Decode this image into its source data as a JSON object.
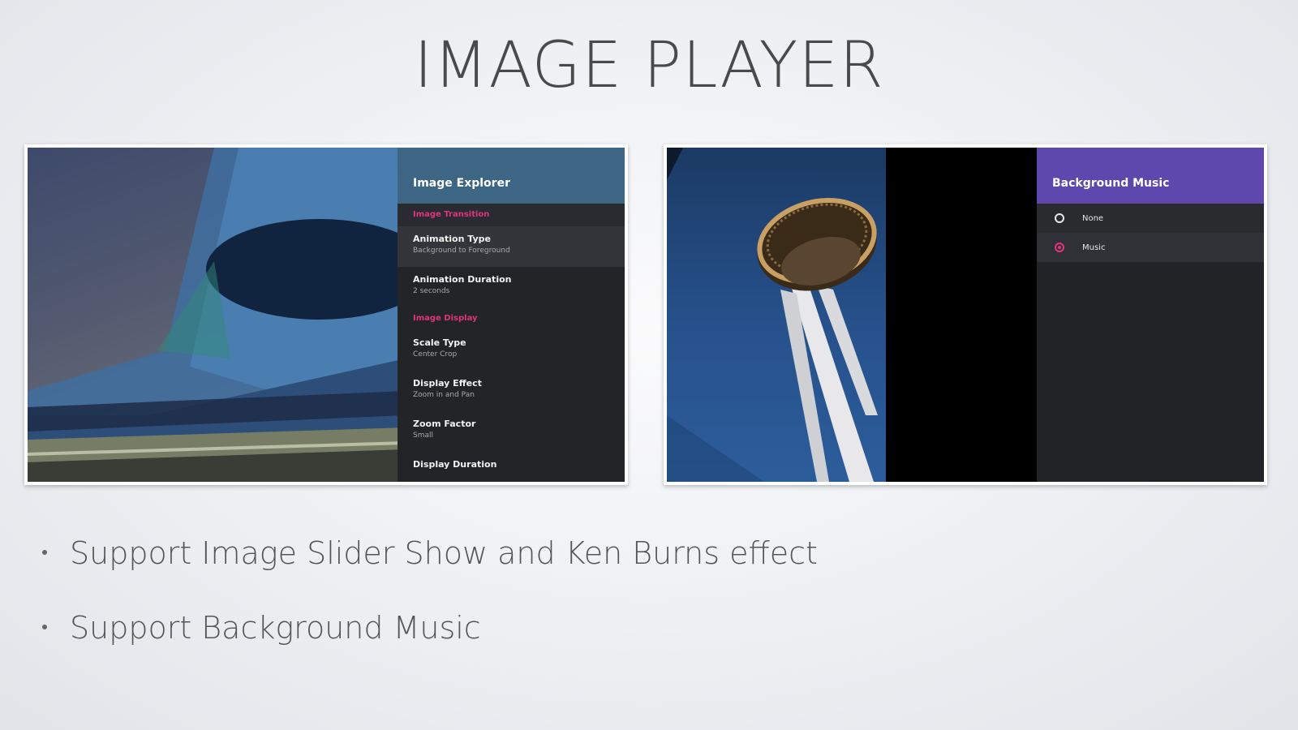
{
  "slide": {
    "title": "IMAGE PLAYER",
    "bullets": [
      "Support Image Slider Show and Ken Burns effect",
      "Support Background Music"
    ]
  },
  "left_screenshot": {
    "panel_title": "Image Explorer",
    "panel_color": "#3d6584",
    "accent_color": "#e0357a",
    "sections": [
      {
        "label": "Image Transition",
        "items": [
          {
            "title": "Animation Type",
            "subtitle": "Background to Foreground"
          },
          {
            "title": "Animation Duration",
            "subtitle": "2 seconds"
          }
        ]
      },
      {
        "label": "Image Display",
        "items": [
          {
            "title": "Scale Type",
            "subtitle": "Center Crop"
          },
          {
            "title": "Display Effect",
            "subtitle": "Zoom in and Pan"
          },
          {
            "title": "Zoom Factor",
            "subtitle": "Small"
          },
          {
            "title": "Display Duration",
            "subtitle": ""
          }
        ]
      }
    ]
  },
  "right_screenshot": {
    "panel_title": "Background Music",
    "panel_color": "#5e48ad",
    "options": [
      {
        "label": "None",
        "selected": false
      },
      {
        "label": "Music",
        "selected": true
      }
    ]
  }
}
